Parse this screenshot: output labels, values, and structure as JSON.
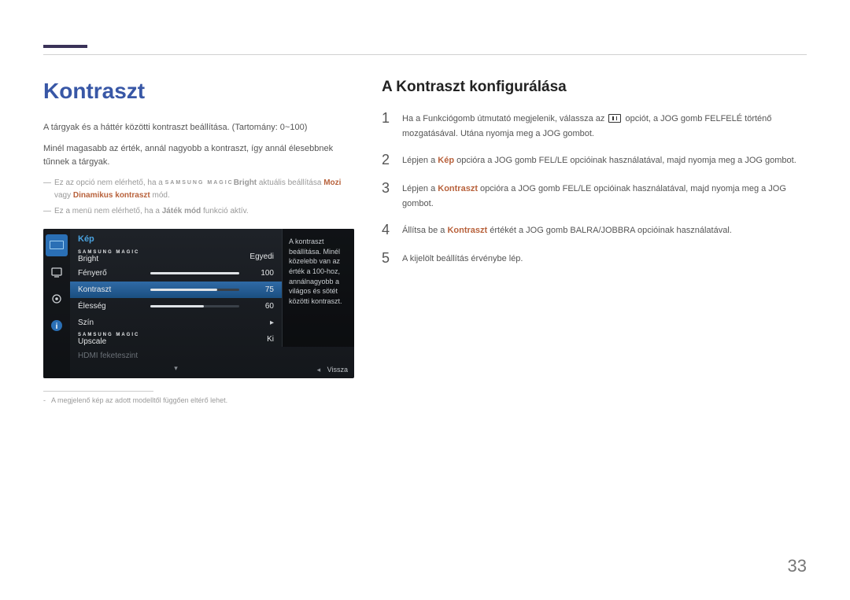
{
  "page_number": "33",
  "left": {
    "heading": "Kontraszt",
    "p1": "A tárgyak és a háttér közötti kontraszt beállítása. (Tartomány: 0~100)",
    "p2": "Minél magasabb az érték, annál nagyobb a kontraszt, így annál élesebbnek tűnnek a tárgyak.",
    "note1_pre": "Ez az opció nem elérhető, ha a ",
    "note1_brand": "SAMSUNG MAGIC",
    "note1_brand_suffix": "Bright",
    "note1_mid": " aktuális beállítása ",
    "note1_hl1": "Mozi",
    "note1_or": " vagy ",
    "note1_hl2": "Dinamikus kontraszt",
    "note1_end": " mód.",
    "note2_pre": "Ez a menü nem elérhető, ha a ",
    "note2_bold": "Játék mód",
    "note2_end": " funkció aktív.",
    "footnote": "A megjelenő kép az adott modelltől függően eltérő lehet."
  },
  "osd": {
    "title": "Kép",
    "rows": [
      {
        "label_brand": "SAMSUNG MAGIC",
        "label_suffix": "Bright",
        "value_text": "Egyedi",
        "type": "text"
      },
      {
        "label": "Fényerő",
        "value": 100,
        "type": "bar"
      },
      {
        "label": "Kontraszt",
        "value": 75,
        "type": "bar",
        "selected": true
      },
      {
        "label": "Élesség",
        "value": 60,
        "type": "bar"
      },
      {
        "label": "Szín",
        "type": "submenu"
      },
      {
        "label_brand": "SAMSUNG MAGIC",
        "label_suffix": "Upscale",
        "value_text": "Ki",
        "type": "text"
      },
      {
        "label": "HDMI feketeszint",
        "type": "disabled"
      }
    ],
    "info": "A kontraszt beállítása. Minél közelebb van az érték a 100-hoz, annálnagyobb a világos és sötét közötti kontraszt.",
    "back": "Vissza"
  },
  "right": {
    "heading": "A Kontraszt konfigurálása",
    "steps": [
      {
        "n": "1",
        "pre": "Ha a Funkciógomb útmutató megjelenik, válassza az ",
        "icon": true,
        "post": " opciót, a JOG gomb FELFELÉ történő mozgatásával. Utána nyomja meg a JOG gombot."
      },
      {
        "n": "2",
        "pre": "Lépjen a ",
        "bold": "Kép",
        "post": " opcióra a JOG gomb FEL/LE opcióinak használatával, majd nyomja meg a JOG gombot."
      },
      {
        "n": "3",
        "pre": "Lépjen a ",
        "bold": "Kontraszt",
        "post": " opcióra a JOG gomb FEL/LE opcióinak használatával, majd nyomja meg a JOG gombot."
      },
      {
        "n": "4",
        "pre": "Állítsa be a ",
        "bold": "Kontraszt",
        "post": " értékét a JOG gomb BALRA/JOBBRA opcióinak használatával."
      },
      {
        "n": "5",
        "pre": "A kijelölt beállítás érvénybe lép."
      }
    ]
  }
}
